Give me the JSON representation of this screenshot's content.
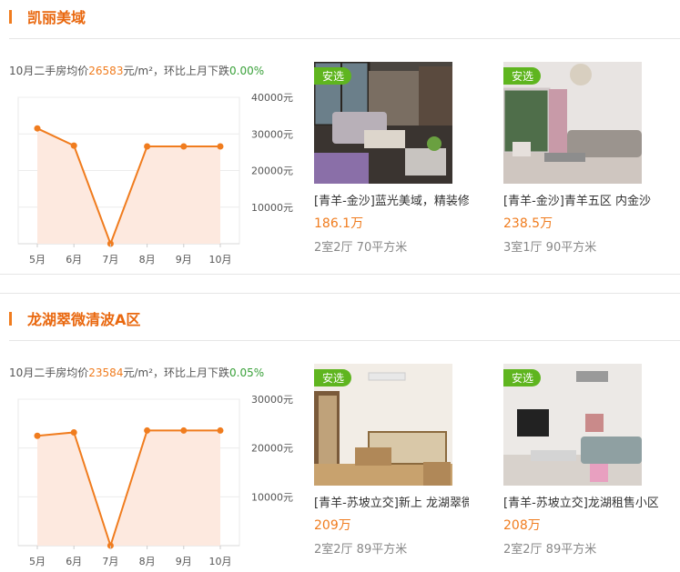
{
  "sections": [
    {
      "title": "凯丽美域",
      "summary": {
        "prefix": "10月二手房均价",
        "price": "26583",
        "unit": "元/m²，环比上月下跌",
        "change": "0.00%"
      },
      "chart_data": {
        "type": "area",
        "categories": [
          "5月",
          "6月",
          "7月",
          "8月",
          "9月",
          "10月"
        ],
        "values": [
          31500,
          26800,
          0,
          26583,
          26583,
          26583
        ],
        "yticks": [
          "40000元",
          "30000元",
          "20000元",
          "10000元"
        ],
        "ylim": [
          0,
          40000
        ],
        "line_color": "#f07c1e",
        "fill_color": "#fde9df"
      },
      "listings": [
        {
          "badge": "安选",
          "title": "[青羊-金沙]蓝光美域，精装修，",
          "price": "186.1万",
          "spec": "2室2厅 70平方米"
        },
        {
          "badge": "安选",
          "title": "[青羊-金沙]青羊五区 内金沙",
          "price": "238.5万",
          "spec": "3室1厅 90平方米"
        }
      ]
    },
    {
      "title": "龙湖翠微清波A区",
      "summary": {
        "prefix": "10月二手房均价",
        "price": "23584",
        "unit": "元/m²，环比上月下跌",
        "change": "0.05%"
      },
      "chart_data": {
        "type": "area",
        "categories": [
          "5月",
          "6月",
          "7月",
          "8月",
          "9月",
          "10月"
        ],
        "values": [
          22500,
          23200,
          0,
          23584,
          23584,
          23584
        ],
        "yticks": [
          "30000元",
          "20000元",
          "10000元"
        ],
        "ylim": [
          0,
          30000
        ],
        "line_color": "#f07c1e",
        "fill_color": "#fde9df"
      },
      "listings": [
        {
          "badge": "安选",
          "title": "[青羊-苏坡立交]新上 龙湖翠微",
          "price": "209万",
          "spec": "2室2厅 89平方米"
        },
        {
          "badge": "安选",
          "title": "[青羊-苏坡立交]龙湖租售小区",
          "price": "208万",
          "spec": "2室2厅 89平方米"
        }
      ]
    }
  ]
}
